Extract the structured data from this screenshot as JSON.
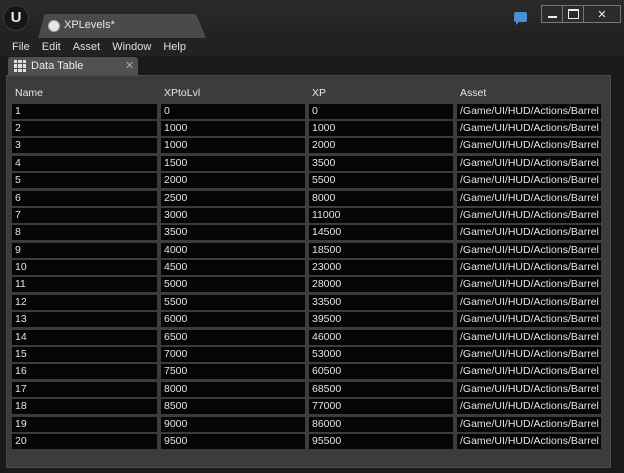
{
  "window": {
    "logo": "U",
    "tab_title": "XPLevels*",
    "controls": {
      "close": "✕"
    }
  },
  "icons": {
    "logo": "unreal-logo-icon",
    "tab": "asset-dot-icon",
    "chat": "chat-bubble-icon",
    "panel": "grid-icon",
    "panel_close": "close-icon"
  },
  "menu": [
    "File",
    "Edit",
    "Asset",
    "Window",
    "Help"
  ],
  "panel": {
    "tab_label": "Data Table",
    "close": "✕"
  },
  "table": {
    "columns": [
      "Name",
      "XPtoLvl",
      "XP",
      "Asset"
    ],
    "rows": [
      [
        "1",
        "0",
        "0",
        "/Game/UI/HUD/Actions/Barrel"
      ],
      [
        "2",
        "1000",
        "1000",
        "/Game/UI/HUD/Actions/Barrel"
      ],
      [
        "3",
        "1000",
        "2000",
        "/Game/UI/HUD/Actions/Barrel"
      ],
      [
        "4",
        "1500",
        "3500",
        "/Game/UI/HUD/Actions/Barrel"
      ],
      [
        "5",
        "2000",
        "5500",
        "/Game/UI/HUD/Actions/Barrel"
      ],
      [
        "6",
        "2500",
        "8000",
        "/Game/UI/HUD/Actions/Barrel"
      ],
      [
        "7",
        "3000",
        "11000",
        "/Game/UI/HUD/Actions/Barrel"
      ],
      [
        "8",
        "3500",
        "14500",
        "/Game/UI/HUD/Actions/Barrel"
      ],
      [
        "9",
        "4000",
        "18500",
        "/Game/UI/HUD/Actions/Barrel"
      ],
      [
        "10",
        "4500",
        "23000",
        "/Game/UI/HUD/Actions/Barrel"
      ],
      [
        "11",
        "5000",
        "28000",
        "/Game/UI/HUD/Actions/Barrel"
      ],
      [
        "12",
        "5500",
        "33500",
        "/Game/UI/HUD/Actions/Barrel"
      ],
      [
        "13",
        "6000",
        "39500",
        "/Game/UI/HUD/Actions/Barrel"
      ],
      [
        "14",
        "6500",
        "46000",
        "/Game/UI/HUD/Actions/Barrel"
      ],
      [
        "15",
        "7000",
        "53000",
        "/Game/UI/HUD/Actions/Barrel"
      ],
      [
        "16",
        "7500",
        "60500",
        "/Game/UI/HUD/Actions/Barrel"
      ],
      [
        "17",
        "8000",
        "68500",
        "/Game/UI/HUD/Actions/Barrel"
      ],
      [
        "18",
        "8500",
        "77000",
        "/Game/UI/HUD/Actions/Barrel"
      ],
      [
        "19",
        "9000",
        "86000",
        "/Game/UI/HUD/Actions/Barrel"
      ],
      [
        "20",
        "9500",
        "95500",
        "/Game/UI/HUD/Actions/Barrel"
      ]
    ]
  },
  "colors": {
    "chrome": "#222222",
    "panel": "#3c3c3c",
    "cell": "#050505",
    "accent": "#4a90d0"
  }
}
